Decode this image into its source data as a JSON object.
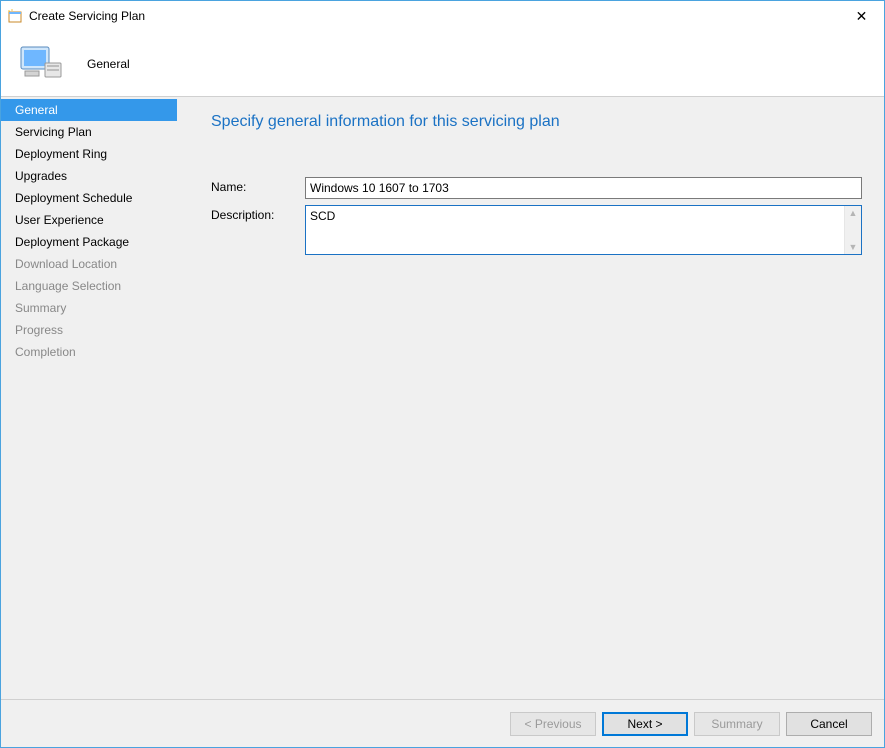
{
  "window": {
    "title": "Create Servicing Plan",
    "close_label": "✕"
  },
  "header": {
    "step_title": "General"
  },
  "sidebar": {
    "items": [
      {
        "label": "General",
        "state": "selected"
      },
      {
        "label": "Servicing Plan",
        "state": "enabled"
      },
      {
        "label": "Deployment Ring",
        "state": "enabled"
      },
      {
        "label": "Upgrades",
        "state": "enabled"
      },
      {
        "label": "Deployment Schedule",
        "state": "enabled"
      },
      {
        "label": "User Experience",
        "state": "enabled"
      },
      {
        "label": "Deployment Package",
        "state": "enabled"
      },
      {
        "label": "Download Location",
        "state": "disabled"
      },
      {
        "label": "Language Selection",
        "state": "disabled"
      },
      {
        "label": "Summary",
        "state": "disabled"
      },
      {
        "label": "Progress",
        "state": "disabled"
      },
      {
        "label": "Completion",
        "state": "disabled"
      }
    ]
  },
  "main": {
    "heading": "Specify general information for this servicing plan",
    "name_label": "Name:",
    "name_value": "Windows 10 1607 to 1703",
    "description_label": "Description:",
    "description_value": "SCD"
  },
  "footer": {
    "previous": "< Previous",
    "next": "Next >",
    "summary": "Summary",
    "cancel": "Cancel"
  }
}
